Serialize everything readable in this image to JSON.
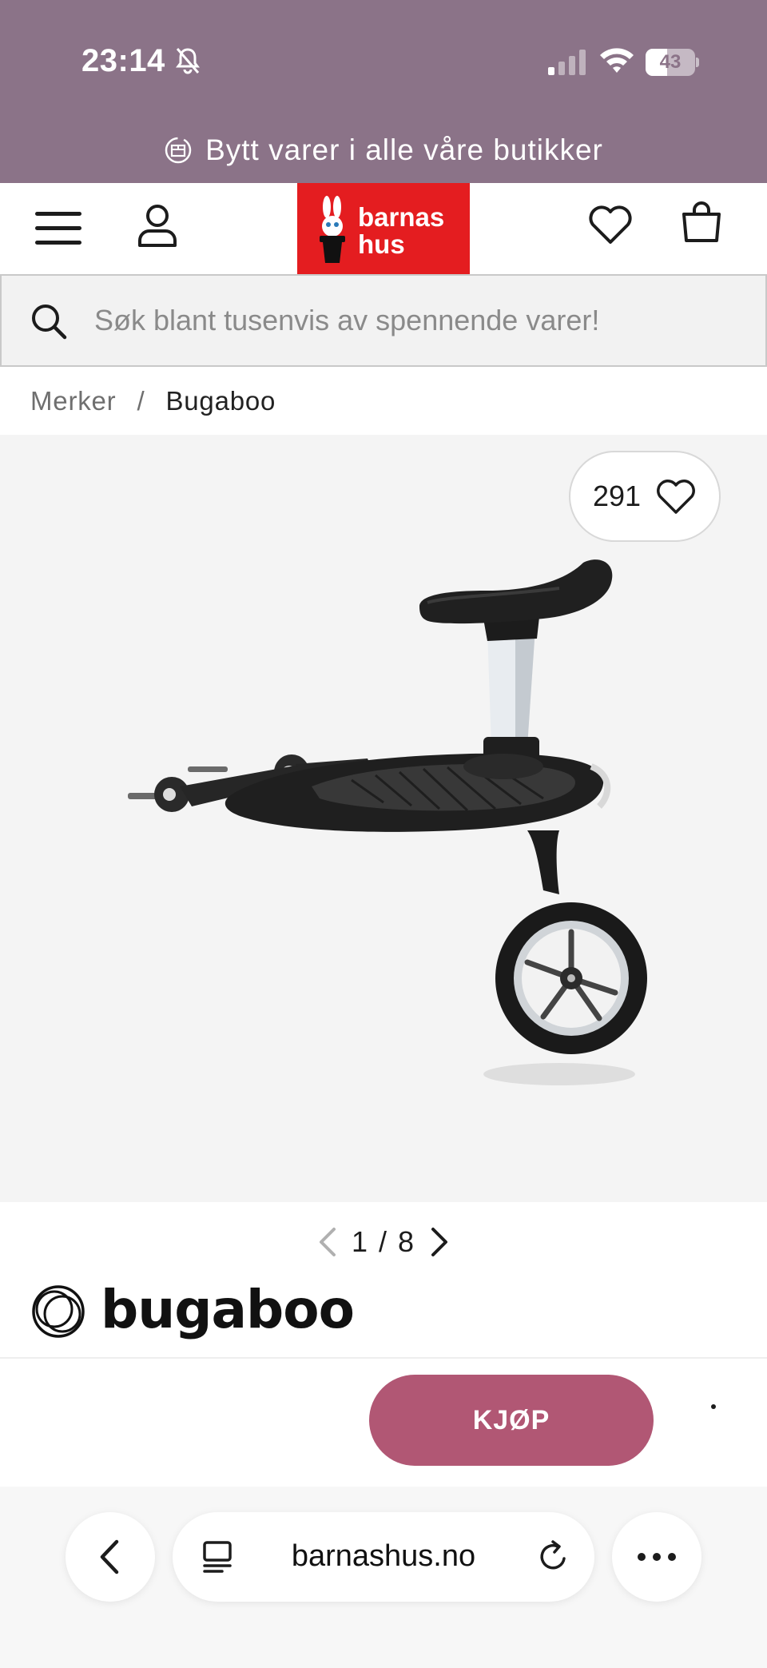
{
  "status_bar": {
    "time": "23:14",
    "battery_level": "43",
    "battery_fraction": 0.43,
    "icons": [
      "bell-slash-icon",
      "signal-icon",
      "wifi-icon",
      "battery-icon"
    ]
  },
  "promo": {
    "text": "Bytt varer i alle våre butikker",
    "icon": "exchange-box-icon",
    "background": "#8b7388"
  },
  "header": {
    "logo_text_line1": "barnas",
    "logo_text_line2": "hus",
    "logo_color": "#e41d20",
    "icons": [
      "menu-icon",
      "user-icon",
      "heart-icon",
      "shopping-bag-icon"
    ]
  },
  "search": {
    "placeholder": "Søk blant tusenvis av spennende varer!"
  },
  "breadcrumb": {
    "items": [
      "Merker",
      "Bugaboo"
    ],
    "separator": "/"
  },
  "product": {
    "favorite_count": "291",
    "pager": {
      "current": "1",
      "total": "8",
      "separator": "/"
    },
    "brand_name": "bugaboo"
  },
  "actions": {
    "buy_label": "KJØP",
    "buy_color": "#b15774"
  },
  "browser": {
    "url": "barnashus.no",
    "icons": [
      "back-chevron-icon",
      "tabs-icon",
      "reload-icon",
      "more-dots-icon"
    ]
  }
}
